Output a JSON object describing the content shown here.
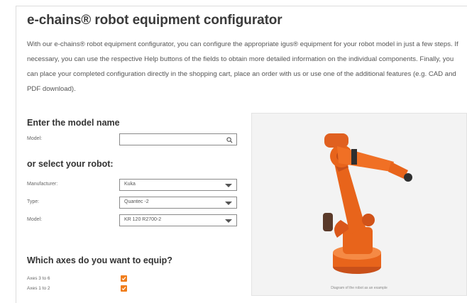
{
  "header": {
    "title": "e-chains® robot equipment configurator"
  },
  "intro": {
    "text": "With our e-chains® robot equipment configurator, you can configure the appropriate igus® equipment for your robot model in just a few steps. If necessary, you can use the respective Help buttons of the fields to obtain more detailed information on the individual components. Finally, you can place your completed configuration directly in the shopping cart, place an order with us or use one of the additional features (e.g. CAD and PDF download)."
  },
  "model_search": {
    "heading": "Enter the model name",
    "label": "Model:",
    "value": "",
    "icon": "search-icon"
  },
  "robot_select": {
    "heading": "or select your robot:",
    "manufacturer_label": "Manufacturer:",
    "manufacturer_value": "Kuka",
    "type_label": "Type:",
    "type_value": "Quantec -2",
    "model_label": "Model:",
    "model_value": "KR 120 R2700-2"
  },
  "axes": {
    "heading": "Which axes do you want to equip?",
    "items": [
      {
        "label": "Axes 3 to 6",
        "checked": true
      },
      {
        "label": "Axes 1 to 2",
        "checked": true
      }
    ]
  },
  "image": {
    "caption": "Diagram of the robot as an example"
  },
  "colors": {
    "accent": "#f07d1b",
    "robot": "#e8641b"
  }
}
